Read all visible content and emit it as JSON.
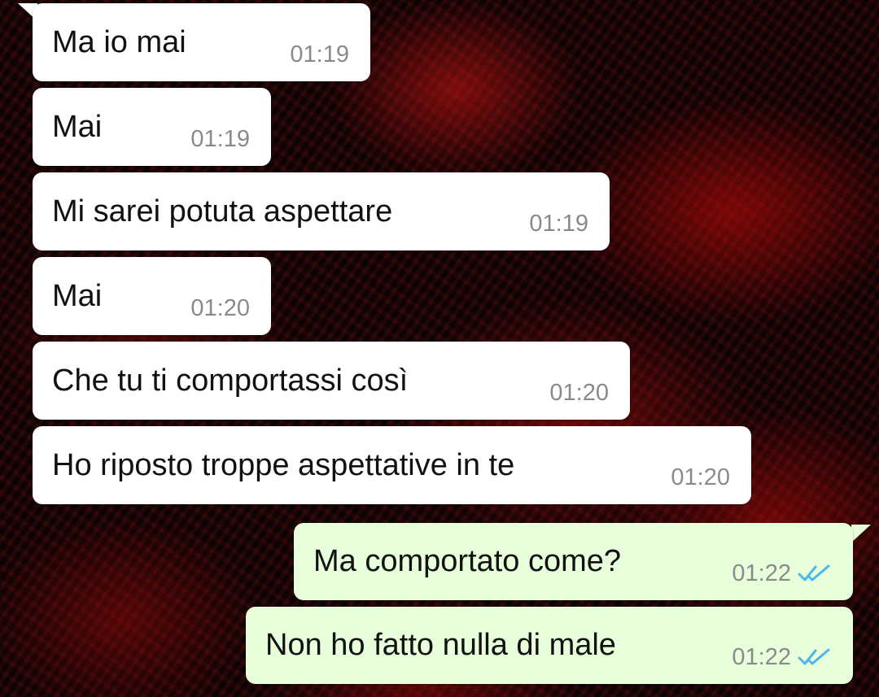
{
  "messages": [
    {
      "direction": "incoming",
      "text": "Ma io mai",
      "time": "01:19"
    },
    {
      "direction": "incoming",
      "text": "Mai",
      "time": "01:19"
    },
    {
      "direction": "incoming",
      "text": "Mi sarei potuta aspettare",
      "time": "01:19"
    },
    {
      "direction": "incoming",
      "text": "Mai",
      "time": "01:20"
    },
    {
      "direction": "incoming",
      "text": "Che tu ti comportassi così",
      "time": "01:20"
    },
    {
      "direction": "incoming",
      "text": "Ho riposto troppe aspettative in te",
      "time": "01:20"
    },
    {
      "direction": "outgoing",
      "text": "Ma comportato come?",
      "time": "01:22",
      "status_icon": "double-check-read-icon"
    },
    {
      "direction": "outgoing",
      "text": "Non ho fatto nulla di male",
      "time": "01:22",
      "status_icon": "double-check-read-icon"
    }
  ],
  "colors": {
    "incoming_bubble": "#ffffff",
    "outgoing_bubble": "#e7ffdb",
    "timestamp": "#8a8a8a",
    "read_tick": "#4fb6ec"
  },
  "wallpaper": "dark red abstract swirl"
}
